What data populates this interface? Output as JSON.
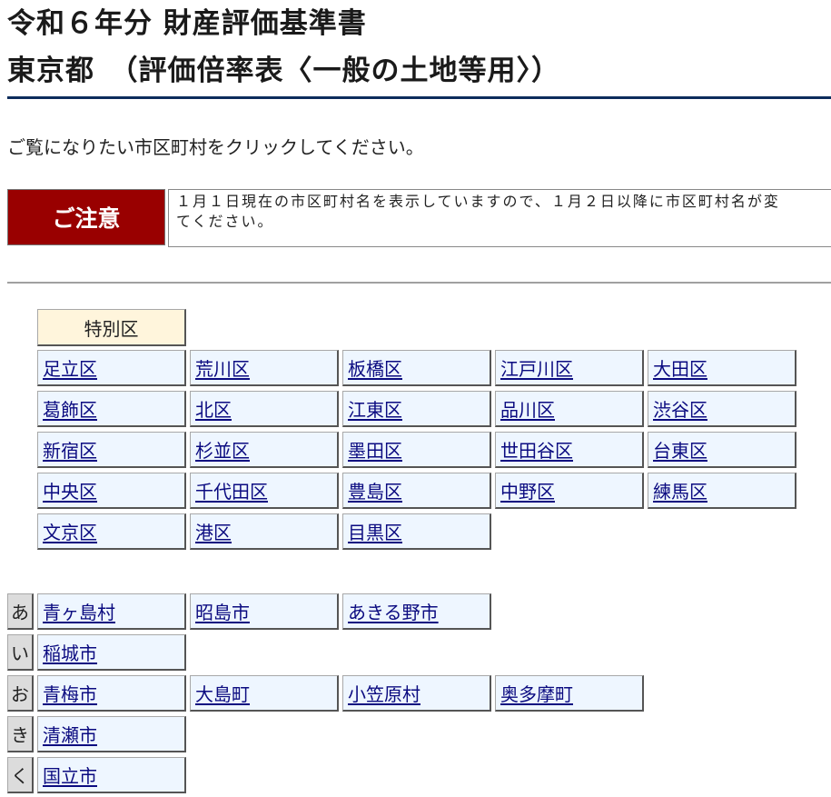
{
  "header": {
    "title_line1": "令和６年分 財産評価基準書",
    "title_line2": "東京都　（評価倍率表〈一般の土地等用〉）"
  },
  "instruction": "ご覧になりたい市区町村をクリックしてください。",
  "notice": {
    "label": "ご注意",
    "text_line1": "１月１日現在の市区町村名を表示していますので、１月２日以降に市区町村名が変",
    "text_line2": "てください。"
  },
  "special_wards": {
    "header": "特別区",
    "rows": [
      [
        "足立区",
        "荒川区",
        "板橋区",
        "江戸川区",
        "大田区"
      ],
      [
        "葛飾区",
        "北区",
        "江東区",
        "品川区",
        "渋谷区"
      ],
      [
        "新宿区",
        "杉並区",
        "墨田区",
        "世田谷区",
        "台東区"
      ],
      [
        "中央区",
        "千代田区",
        "豊島区",
        "中野区",
        "練馬区"
      ],
      [
        "文京区",
        "港区",
        "目黒区"
      ]
    ]
  },
  "municipalities": [
    {
      "kana": "あ",
      "items": [
        "青ヶ島村",
        "昭島市",
        "あきる野市"
      ]
    },
    {
      "kana": "い",
      "items": [
        "稲城市"
      ]
    },
    {
      "kana": "お",
      "items": [
        "青梅市",
        "大島町",
        "小笠原村",
        "奥多摩町"
      ]
    },
    {
      "kana": "き",
      "items": [
        "清瀬市"
      ]
    },
    {
      "kana": "く",
      "items": [
        "国立市"
      ]
    }
  ],
  "colors": {
    "notice_label_bg": "#990000",
    "title_rule": "#0d2c5c",
    "link": "#0b0b80",
    "cell_bg": "#eef6ff",
    "header_bg": "#fff5dc",
    "kana_bg": "#dcdcdc"
  }
}
